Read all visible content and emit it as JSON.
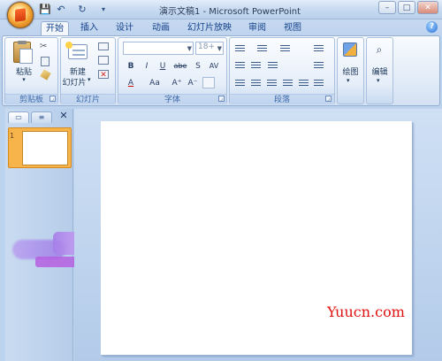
{
  "window": {
    "title": "演示文稿1 - Microsoft PowerPoint",
    "controls": {
      "minimize": "–",
      "maximize": "□",
      "close": "✕"
    }
  },
  "quick_access": {
    "save": "💾",
    "undo": "↶",
    "redo": "↻",
    "customize": "▾"
  },
  "tabs": [
    {
      "label": "开始",
      "active": true
    },
    {
      "label": "插入",
      "active": false
    },
    {
      "label": "设计",
      "active": false
    },
    {
      "label": "动画",
      "active": false
    },
    {
      "label": "幻灯片放映",
      "active": false
    },
    {
      "label": "审阅",
      "active": false
    },
    {
      "label": "视图",
      "active": false
    }
  ],
  "help": "?",
  "ribbon": {
    "clipboard": {
      "label": "剪贴板",
      "paste_label": "粘贴",
      "paste_arrow": "▾"
    },
    "slides": {
      "label": "幻灯片",
      "new_slide_line1": "新建",
      "new_slide_line2": "幻灯片",
      "new_slide_arrow": "▾"
    },
    "font": {
      "label": "字体",
      "font_name": "",
      "font_size": "18+",
      "buttons": [
        "B",
        "I",
        "U",
        "abe",
        "S",
        "AV",
        "A",
        "Aa",
        "A⁺",
        "A⁻"
      ]
    },
    "paragraph": {
      "label": "段落"
    },
    "drawing": {
      "label": "绘图",
      "arrow": "▾"
    },
    "editing": {
      "label": "编辑",
      "arrow": "▾"
    }
  },
  "left_pane": {
    "slide_number": "1",
    "close": "✕"
  },
  "watermark": "Yuucn.com",
  "colors": {
    "ribbon_text": "#15428b",
    "thumbnail_selected": "#f7b44a",
    "watermark": "#e01010"
  }
}
